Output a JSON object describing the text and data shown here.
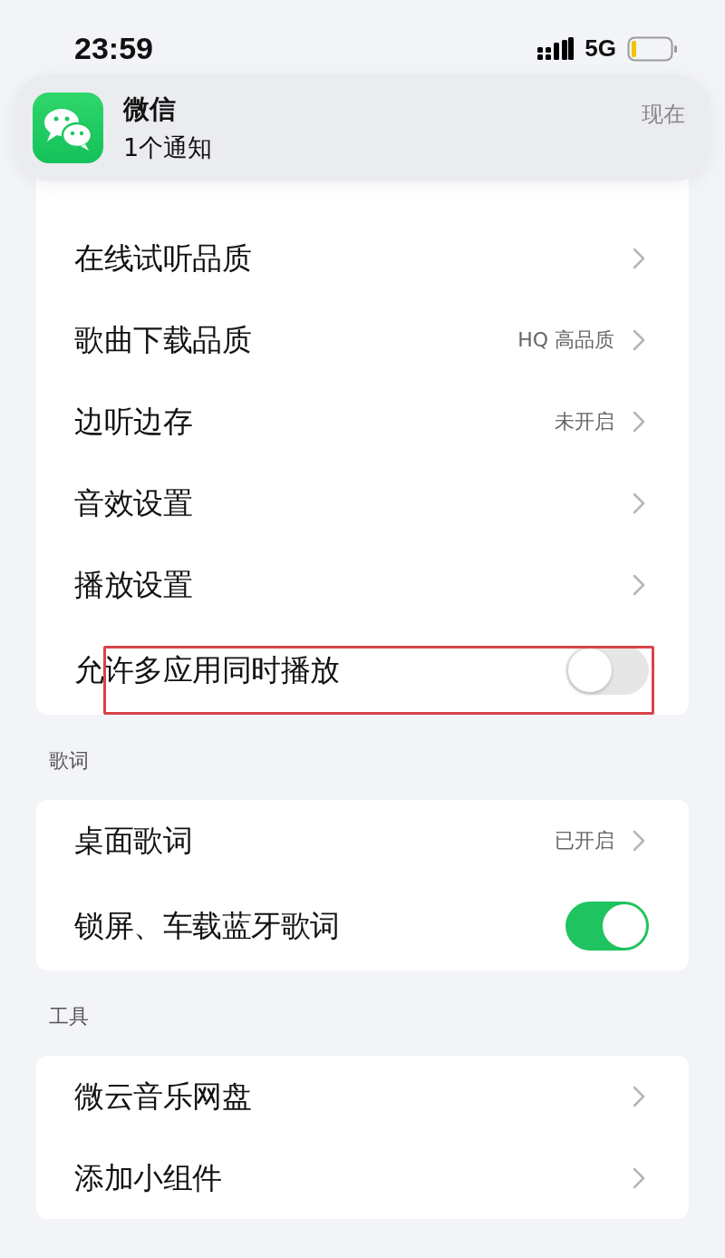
{
  "status_bar": {
    "time": "23:59",
    "network": "5G"
  },
  "notification": {
    "app": "微信",
    "message": "1个通知",
    "time": "现在"
  },
  "sections": [
    {
      "rows": [
        {
          "label": "在线试听品质",
          "kind": "link",
          "highlighted": false
        },
        {
          "label": "歌曲下载品质",
          "kind": "link",
          "value": "HQ 高品质",
          "highlighted": false
        },
        {
          "label": "边听边存",
          "kind": "link",
          "value": "未开启",
          "highlighted": false
        },
        {
          "label": "音效设置",
          "kind": "link",
          "highlighted": false
        },
        {
          "label": "播放设置",
          "kind": "link",
          "highlighted": false
        },
        {
          "label": "允许多应用同时播放",
          "kind": "toggle",
          "on": false,
          "highlighted": true
        }
      ]
    },
    {
      "header": "歌词",
      "rows": [
        {
          "label": "桌面歌词",
          "kind": "link",
          "value": "已开启",
          "highlighted": false
        },
        {
          "label": "锁屏、车载蓝牙歌词",
          "kind": "toggle",
          "on": true,
          "highlighted": false
        }
      ]
    },
    {
      "header": "工具",
      "rows": [
        {
          "label": "微云音乐网盘",
          "kind": "link",
          "highlighted": false
        },
        {
          "label": "添加小组件",
          "kind": "link",
          "highlighted": false
        }
      ]
    }
  ]
}
